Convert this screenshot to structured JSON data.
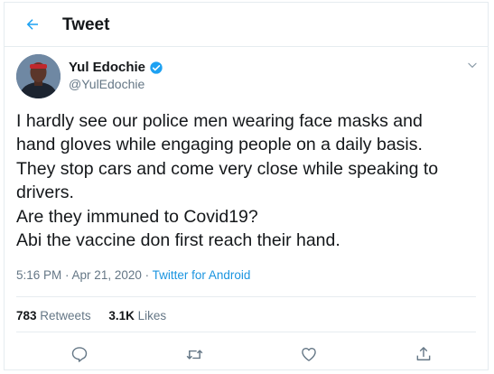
{
  "header": {
    "title": "Tweet",
    "back_icon": "back-arrow-icon"
  },
  "author": {
    "name": "Yul Edochie",
    "handle": "@YulEdochie",
    "verified": true
  },
  "tweet": {
    "lines": [
      "I hardly see our police men wearing face masks and",
      "hand gloves while engaging people on a daily basis.",
      "They stop cars and come very close while speaking to",
      "drivers.",
      "Are they immuned to Covid19?",
      "Abi the vaccine don first reach their hand."
    ],
    "time": "5:16 PM",
    "separator": " · ",
    "date": "Apr 21, 2020",
    "source": "Twitter for Android"
  },
  "stats": {
    "retweets_count": "783",
    "retweets_label": "Retweets",
    "likes_count": "3.1K",
    "likes_label": "Likes"
  },
  "actions": [
    "reply-icon",
    "retweet-icon",
    "like-icon",
    "share-icon"
  ],
  "colors": {
    "accent": "#1da1f2",
    "link": "#1b95e0",
    "muted": "#657786",
    "text": "#14171a",
    "border": "#e6ecf0"
  }
}
